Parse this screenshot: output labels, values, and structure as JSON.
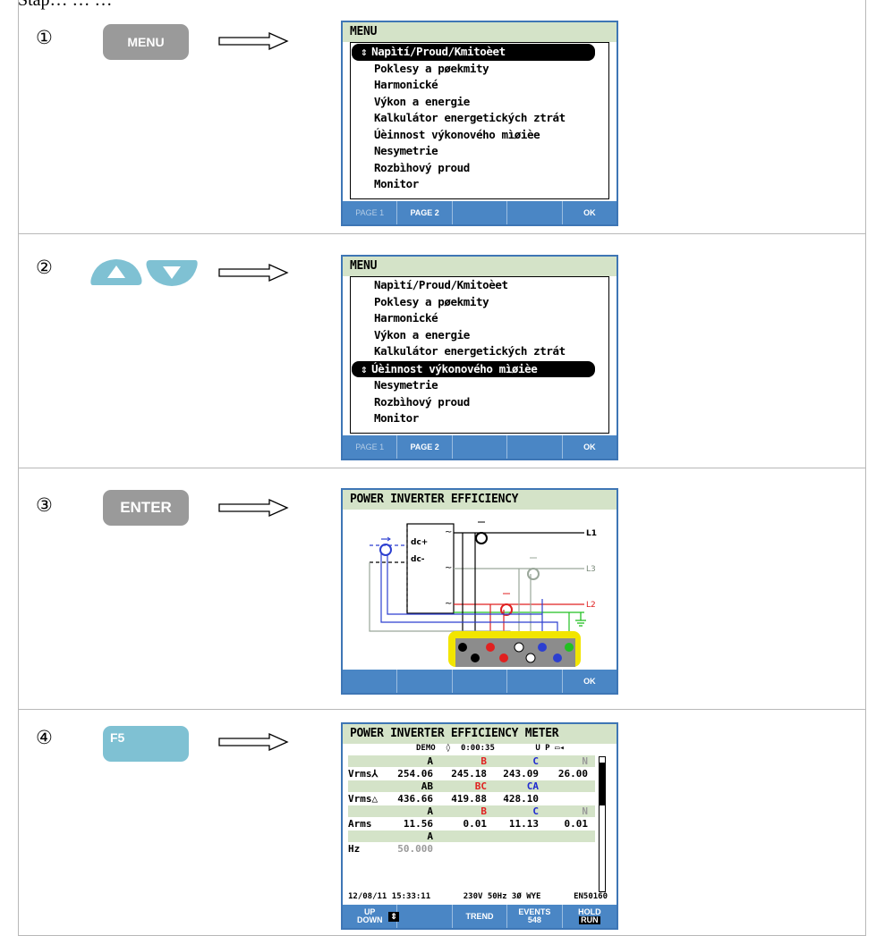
{
  "caption": "Stap… … …",
  "steps": [
    {
      "num": "①",
      "key": "MENU",
      "screen": {
        "title": "MENU",
        "items": [
          "Napìtí/Proud/Kmitoèet",
          "Poklesy a pøekmity",
          "Harmonické",
          "Výkon a energie",
          "Kalkulátor energetických ztrát",
          "Úèinnost výkonového mìøièe",
          "Nesymetrie",
          "Rozbìhový proud",
          "Monitor"
        ],
        "selected_index": 0,
        "fkeys": [
          "PAGE 1",
          "PAGE 2",
          "",
          "",
          "OK"
        ]
      }
    },
    {
      "num": "②",
      "key_icons": [
        "up-arrow-key",
        "down-arrow-key"
      ],
      "screen": {
        "title": "MENU",
        "items": [
          "Napìtí/Proud/Kmitoèet",
          "Poklesy a pøekmity",
          "Harmonické",
          "Výkon a energie",
          "Kalkulátor energetických ztrát",
          "Úèinnost výkonového mìøièe",
          "Nesymetrie",
          "Rozbìhový proud",
          "Monitor"
        ],
        "selected_index": 5,
        "fkeys": [
          "PAGE 1",
          "PAGE 2",
          "",
          "",
          "OK"
        ]
      }
    },
    {
      "num": "③",
      "key": "ENTER",
      "screen": {
        "title": "POWER INVERTER EFFICIENCY",
        "labels": {
          "dcp": "dc+",
          "dcm": "dc-",
          "l1": "L1",
          "l2": "L2",
          "l3": "L3"
        },
        "fkeys": [
          "",
          "",
          "",
          "",
          "OK"
        ]
      }
    },
    {
      "num": "④",
      "key": "F5",
      "screen": {
        "title": "POWER INVERTER EFFICIENCY METER",
        "status": {
          "mode": "DEMO",
          "time": "0:00:35",
          "flags": "U P"
        },
        "rows": [
          {
            "h": true,
            "cells": [
              "",
              "A",
              "B",
              "C",
              "N"
            ]
          },
          {
            "h": false,
            "cells": [
              "Vrms⅄",
              "254.06",
              "245.18",
              "243.09",
              "26.00"
            ]
          },
          {
            "h": true,
            "cells": [
              "",
              "AB",
              "BC",
              "CA",
              ""
            ]
          },
          {
            "h": false,
            "cells": [
              "Vrms△",
              "436.66",
              "419.88",
              "428.10",
              ""
            ]
          },
          {
            "h": true,
            "cells": [
              "",
              "A",
              "B",
              "C",
              "N"
            ]
          },
          {
            "h": false,
            "cells": [
              "Arms",
              "11.56",
              "0.01",
              "11.13",
              "0.01"
            ]
          },
          {
            "h": true,
            "cells": [
              "",
              "A",
              "",
              "",
              ""
            ]
          },
          {
            "h": false,
            "cells": [
              "Hz",
              "50.000",
              "",
              "",
              ""
            ]
          }
        ],
        "footer": {
          "date": "12/08/11",
          "clock": "15:33:11",
          "config": "230V  50Hz 3Ø WYE",
          "standard": "EN50160"
        },
        "fkeys": [
          {
            "l1": "UP",
            "l2": "DOWN"
          },
          {
            "l1": "",
            "l2": ""
          },
          {
            "l1": "TREND",
            "l2": ""
          },
          {
            "l1": "EVENTS",
            "l2": "548"
          },
          {
            "l1": "HOLD",
            "l2": "RUN"
          }
        ]
      }
    }
  ],
  "colors": {
    "screen_border": "#3e76b5",
    "header_bg": "#d4e3c8",
    "key_grey": "#9a9a9a",
    "key_blue": "#7fc1d3"
  }
}
